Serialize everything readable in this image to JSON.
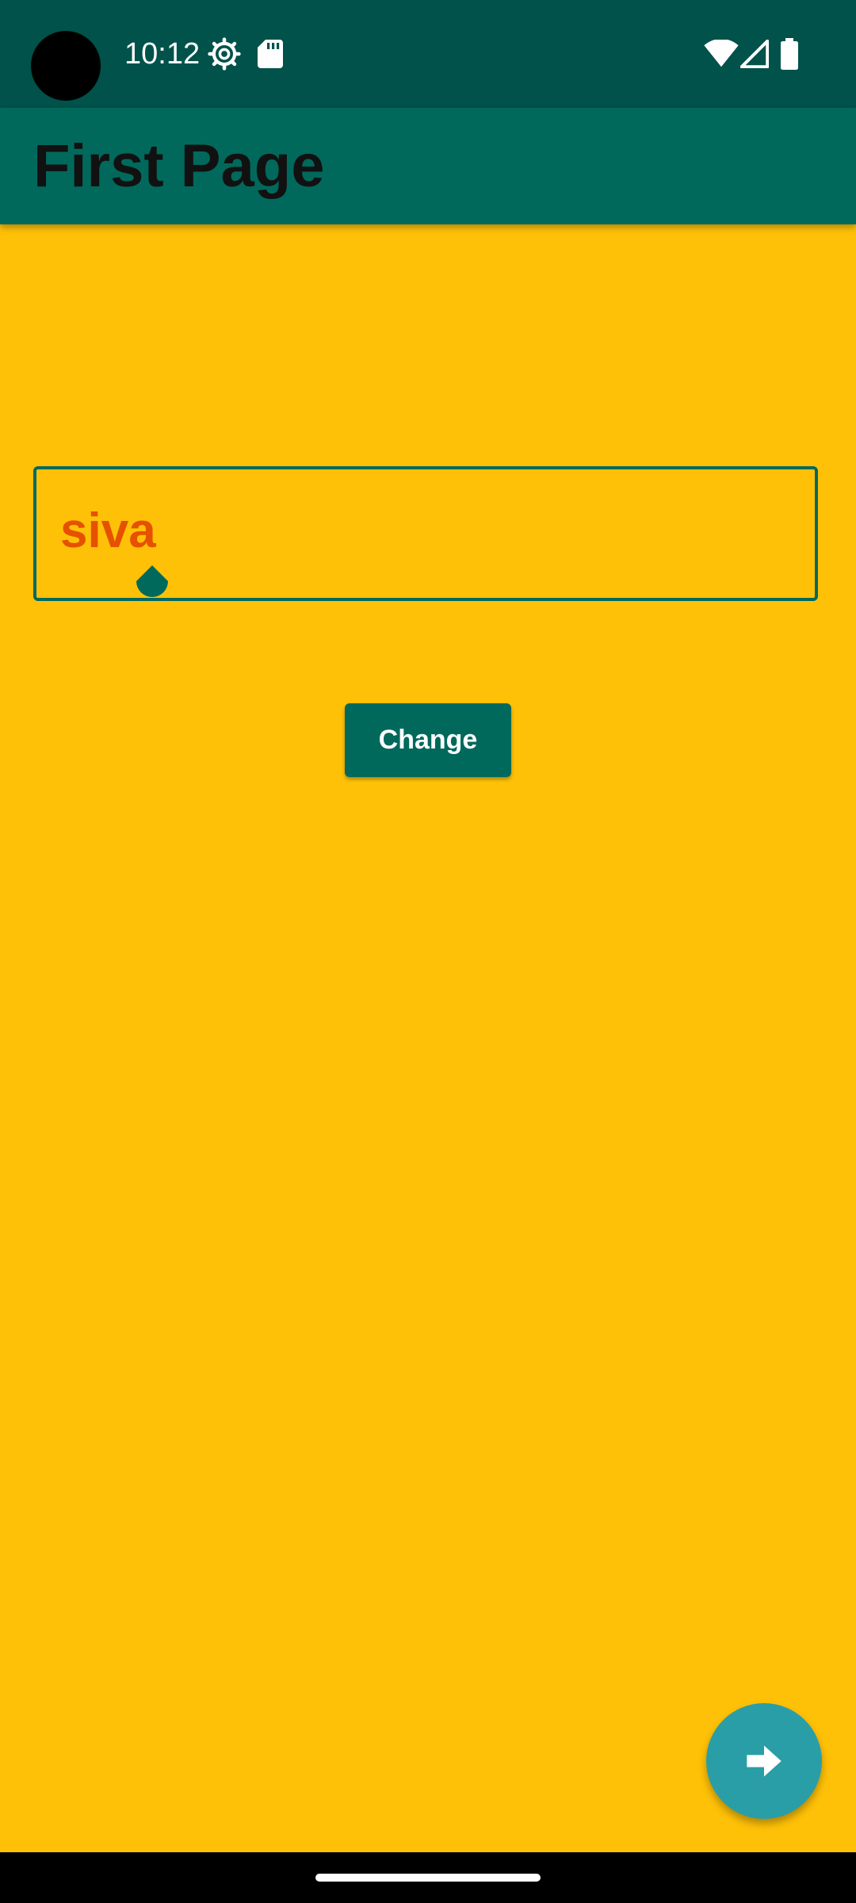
{
  "status_bar": {
    "time": "10:12",
    "icons": [
      "settings-icon",
      "sd-card-icon",
      "wifi-icon",
      "signal-icon",
      "battery-icon"
    ]
  },
  "app_bar": {
    "title": "First Page"
  },
  "text_field": {
    "value": "siva"
  },
  "change_button": {
    "label": "Change"
  },
  "fab": {
    "icon": "arrow-forward-icon"
  },
  "colors": {
    "background": "#FFC107",
    "status_bar": "#00524A",
    "app_bar": "#00695C",
    "accent": "#00695C",
    "text_value": "#E65100",
    "fab": "#2A9EA7"
  }
}
